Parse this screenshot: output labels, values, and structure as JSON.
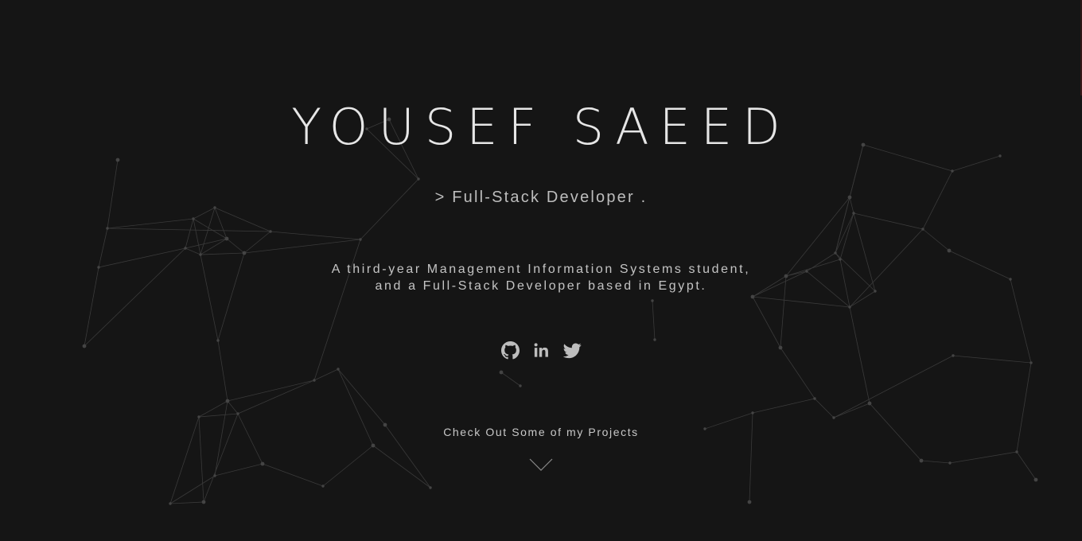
{
  "hero": {
    "name": "YOUSEF SAEED",
    "role": "> Full-Stack Developer .",
    "bio_line_1": "A third-year Management Information Systems student,",
    "bio_line_2": "and a Full-Stack Developer based in Egypt.",
    "cta": "Check Out Some of my Projects"
  },
  "socials": [
    {
      "icon": "github-icon"
    },
    {
      "icon": "linkedin-icon"
    },
    {
      "icon": "twitter-icon"
    }
  ],
  "colors": {
    "background": "#151515",
    "text": "#e6e6e6",
    "network_line": "#3a3a3a",
    "network_node": "#444444"
  }
}
